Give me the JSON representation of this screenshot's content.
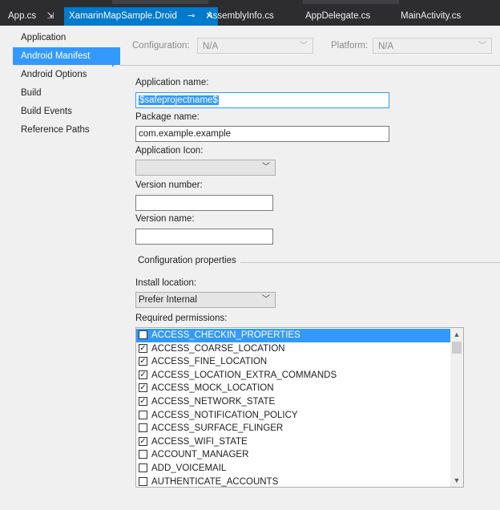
{
  "tabs": [
    {
      "label": "App.cs",
      "pin": "⇲",
      "active": false
    },
    {
      "label": "XamarinMapSample.Droid",
      "pin": "⊸",
      "close": "✕",
      "active": true
    },
    {
      "label": "AssemblyInfo.cs",
      "active": false
    },
    {
      "label": "AppDelegate.cs",
      "active": false
    },
    {
      "label": "MainActivity.cs",
      "active": false
    }
  ],
  "nav": {
    "items": [
      "Application",
      "Android Manifest",
      "Android Options",
      "Build",
      "Build Events",
      "Reference Paths"
    ],
    "active_index": 1
  },
  "config": {
    "configuration_label": "Configuration:",
    "configuration_value": "N/A",
    "platform_label": "Platform:",
    "platform_value": "N/A"
  },
  "form": {
    "app_name_label": "Application name:",
    "app_name_value": "$safeprojectname$",
    "package_name_label": "Package name:",
    "package_name_value": "com.example.example",
    "app_icon_label": "Application Icon:",
    "app_icon_value": "",
    "version_number_label": "Version number:",
    "version_number_value": "",
    "version_name_label": "Version name:",
    "version_name_value": "",
    "group_label": "Configuration properties",
    "install_location_label": "Install location:",
    "install_location_value": "Prefer Internal",
    "permissions_label": "Required permissions:"
  },
  "permissions": [
    {
      "name": "ACCESS_CHECKIN_PROPERTIES",
      "checked": false,
      "selected": true
    },
    {
      "name": "ACCESS_COARSE_LOCATION",
      "checked": true
    },
    {
      "name": "ACCESS_FINE_LOCATION",
      "checked": true
    },
    {
      "name": "ACCESS_LOCATION_EXTRA_COMMANDS",
      "checked": true
    },
    {
      "name": "ACCESS_MOCK_LOCATION",
      "checked": true
    },
    {
      "name": "ACCESS_NETWORK_STATE",
      "checked": true
    },
    {
      "name": "ACCESS_NOTIFICATION_POLICY",
      "checked": false
    },
    {
      "name": "ACCESS_SURFACE_FLINGER",
      "checked": false
    },
    {
      "name": "ACCESS_WIFI_STATE",
      "checked": true
    },
    {
      "name": "ACCOUNT_MANAGER",
      "checked": false
    },
    {
      "name": "ADD_VOICEMAIL",
      "checked": false
    },
    {
      "name": "AUTHENTICATE_ACCOUNTS",
      "checked": false
    }
  ],
  "colors": {
    "accent": "#007acc",
    "selection": "#3399ff",
    "tabbar_bg": "#2d2d30"
  }
}
